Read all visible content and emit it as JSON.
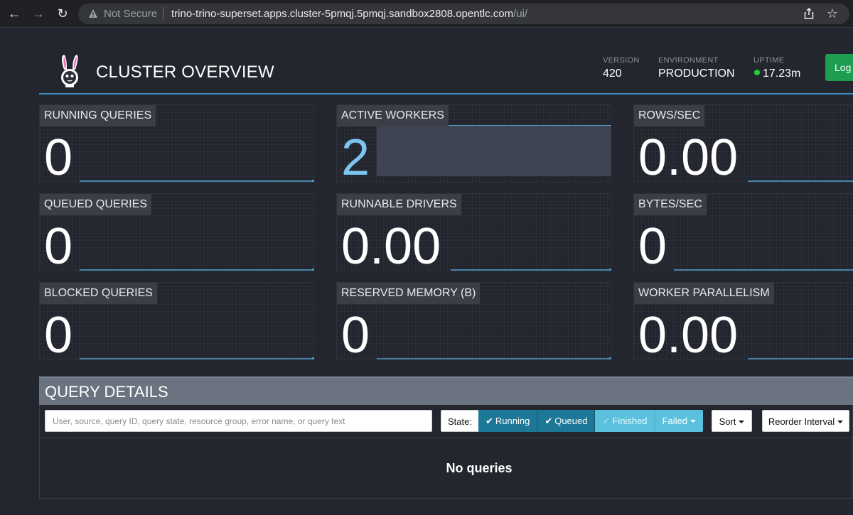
{
  "browser": {
    "security_label": "Not Secure",
    "url_host": "trino-trino-superset.apps.cluster-5pmqj.5pmqj.sandbox2808.opentlc.com",
    "url_path": "/ui/"
  },
  "header": {
    "title": "CLUSTER OVERVIEW",
    "version_label": "VERSION",
    "version_value": "420",
    "environment_label": "ENVIRONMENT",
    "environment_value": "PRODUCTION",
    "uptime_label": "UPTIME",
    "uptime_value": "17.23m",
    "uptime_status_color": "#25d13a",
    "login_label": "Log"
  },
  "stats": {
    "running_queries": {
      "label": "RUNNING QUERIES",
      "value": "0"
    },
    "active_workers": {
      "label": "ACTIVE WORKERS",
      "value": "2"
    },
    "rows_sec": {
      "label": "ROWS/SEC",
      "value": "0.00"
    },
    "queued_queries": {
      "label": "QUEUED QUERIES",
      "value": "0"
    },
    "runnable_drivers": {
      "label": "RUNNABLE DRIVERS",
      "value": "0.00"
    },
    "bytes_sec": {
      "label": "BYTES/SEC",
      "value": "0"
    },
    "blocked_queries": {
      "label": "BLOCKED QUERIES",
      "value": "0"
    },
    "reserved_memory": {
      "label": "RESERVED MEMORY (B)",
      "value": "0"
    },
    "worker_parallelism": {
      "label": "WORKER PARALLELISM",
      "value": "0.00"
    }
  },
  "query_details": {
    "title": "QUERY DETAILS",
    "search_placeholder": "User, source, query ID, query state, resource group, error name, or query text",
    "state_label": "State:",
    "states": {
      "running": "Running",
      "queued": "Queued",
      "finished": "Finished",
      "failed": "Failed"
    },
    "sort_label": "Sort",
    "reorder_label": "Reorder Interval",
    "empty_message": "No queries"
  },
  "colors": {
    "accent": "#3f8fc4",
    "state_on": "#1d7796",
    "state_off": "#5bc0de",
    "active_value": "#7ac5ee"
  }
}
